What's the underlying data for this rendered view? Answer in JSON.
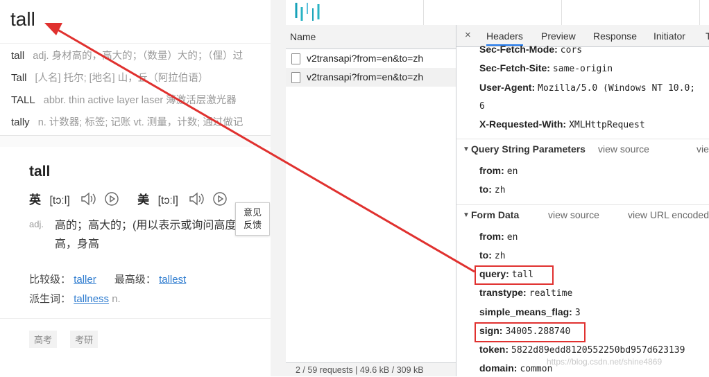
{
  "dict": {
    "query": "tall",
    "suggestions": [
      {
        "word": "tall",
        "def": "adj. 身材高的，高大的；（数量）大的；（俚）过"
      },
      {
        "word": "Tall",
        "def": "[人名] 托尔; [地名] 山，丘（阿拉伯语）"
      },
      {
        "word": "TALL",
        "def": "abbr. thin active layer laser 薄激活层激光器"
      },
      {
        "word": "tally",
        "def": "n. 计数器; 标签; 记账 vt. 测量，计数; 通过做记"
      }
    ],
    "entry": {
      "word": "tall",
      "uk_label": "英",
      "uk_phonetic": "[tɔːl]",
      "us_label": "美",
      "us_phonetic": "[tɔːl]",
      "pos": "adj.",
      "definition": "高的；高大的；(用以表示或询问高度)有…高，身高",
      "comparative_label": "比较级：",
      "comparative": "taller",
      "superlative_label": "最高级：",
      "superlative": "tallest",
      "derivative_label": "派生词：",
      "derivative": "tallness",
      "derivative_pos": "n.",
      "tags": [
        "高考",
        "考研"
      ]
    },
    "feedback": [
      "意见",
      "反馈"
    ]
  },
  "devtools": {
    "name_header": "Name",
    "requests": [
      "v2transapi?from=en&to=zh",
      "v2transapi?from=en&to=zh"
    ],
    "status_bar": "2 / 59 requests  |  49.6 kB / 309 kB",
    "tab_close": "×",
    "tabs": [
      "Headers",
      "Preview",
      "Response",
      "Initiator",
      "T"
    ],
    "request_headers": [
      {
        "k": "Sec-Fetch-Mode:",
        "v": "cors"
      },
      {
        "k": "Sec-Fetch-Site:",
        "v": "same-origin"
      },
      {
        "k": "User-Agent:",
        "v": "Mozilla/5.0 (Windows NT 10.0;"
      },
      {
        "k": "",
        "v": "6"
      },
      {
        "k": "X-Requested-With:",
        "v": "XMLHttpRequest"
      }
    ],
    "query_section": {
      "title": "Query String Parameters",
      "view_source": "view source",
      "view_decoded": "vie"
    },
    "query_params": [
      {
        "k": "from:",
        "v": "en"
      },
      {
        "k": "to:",
        "v": "zh"
      }
    ],
    "form_section": {
      "title": "Form Data",
      "view_source": "view source",
      "view_url": "view URL encoded"
    },
    "form_data": [
      {
        "k": "from:",
        "v": "en"
      },
      {
        "k": "to:",
        "v": "zh"
      },
      {
        "k": "query:",
        "v": "tall"
      },
      {
        "k": "transtype:",
        "v": "realtime"
      },
      {
        "k": "simple_means_flag:",
        "v": "3"
      },
      {
        "k": "sign:",
        "v": "34005.288740"
      },
      {
        "k": "token:",
        "v": "5822d89edd8120552250bd957d623139"
      },
      {
        "k": "domain:",
        "v": "common"
      }
    ]
  },
  "watermark": "https://blog.csdn.net/shine4869",
  "colors": {
    "annotation_red": "#e0312f",
    "link_blue": "#2d7bcf",
    "tab_accent": "#1a73e8"
  }
}
